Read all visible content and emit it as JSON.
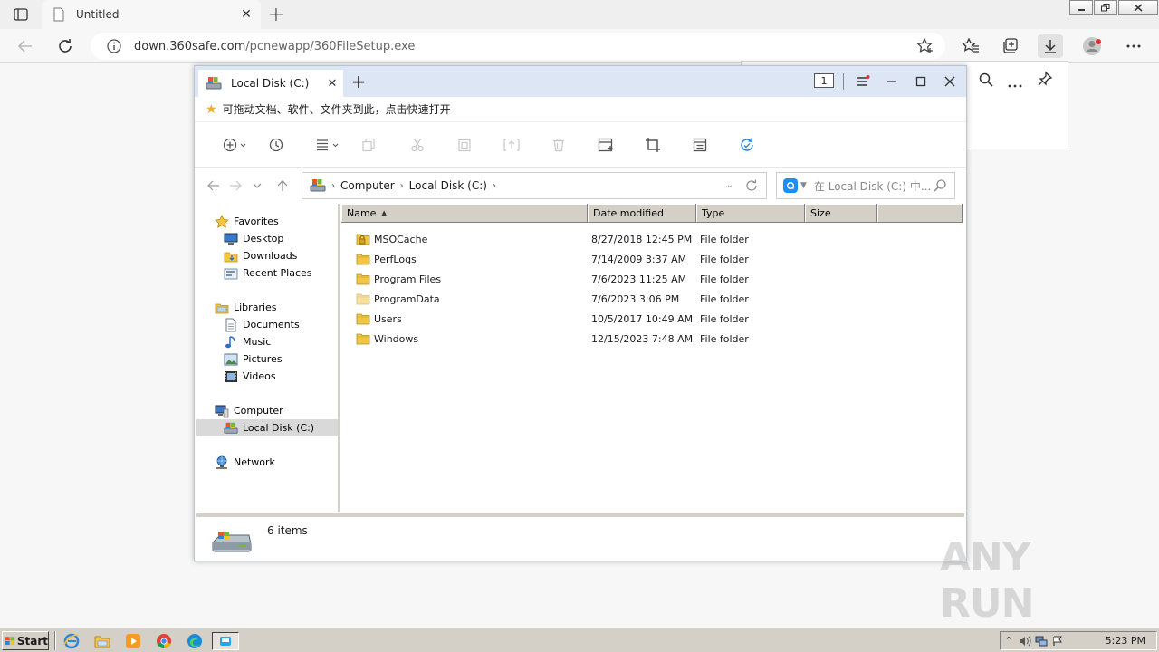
{
  "browser": {
    "tab_title": "Untitled",
    "url_host": "down.360safe.com",
    "url_path": "/pcnewapp/360FileSetup.exe"
  },
  "explorer": {
    "tab_title": "Local Disk (C:)",
    "tab_count_badge": "1",
    "notice": "可拖动文档、软件、文件夹到此，点击快速打开",
    "breadcrumb": [
      "Computer",
      "Local Disk (C:)"
    ],
    "search_placeholder": "在 Local Disk (C:) 中...",
    "nav": {
      "favorites": "Favorites",
      "desktop": "Desktop",
      "downloads": "Downloads",
      "recent": "Recent Places",
      "libraries": "Libraries",
      "documents": "Documents",
      "music": "Music",
      "pictures": "Pictures",
      "videos": "Videos",
      "computer": "Computer",
      "local_disk": "Local Disk (C:)",
      "network": "Network"
    },
    "columns": {
      "name": "Name",
      "date": "Date modified",
      "type": "Type",
      "size": "Size"
    },
    "files": [
      {
        "name": "MSOCache",
        "date": "8/27/2018 12:45 PM",
        "type": "File folder"
      },
      {
        "name": "PerfLogs",
        "date": "7/14/2009 3:37 AM",
        "type": "File folder"
      },
      {
        "name": "Program Files",
        "date": "7/6/2023 11:25 AM",
        "type": "File folder"
      },
      {
        "name": "ProgramData",
        "date": "7/6/2023 3:06 PM",
        "type": "File folder"
      },
      {
        "name": "Users",
        "date": "10/5/2017 10:49 AM",
        "type": "File folder"
      },
      {
        "name": "Windows",
        "date": "12/15/2023 7:48 AM",
        "type": "File folder"
      }
    ],
    "status": "6 items"
  },
  "watermark": "ANY RUN",
  "taskbar": {
    "start": "Start",
    "clock": "5:23 PM"
  },
  "colors": {
    "accent": "#1e8ef5",
    "folder": "#f0c64a",
    "titlebar": "#dce6f4"
  }
}
